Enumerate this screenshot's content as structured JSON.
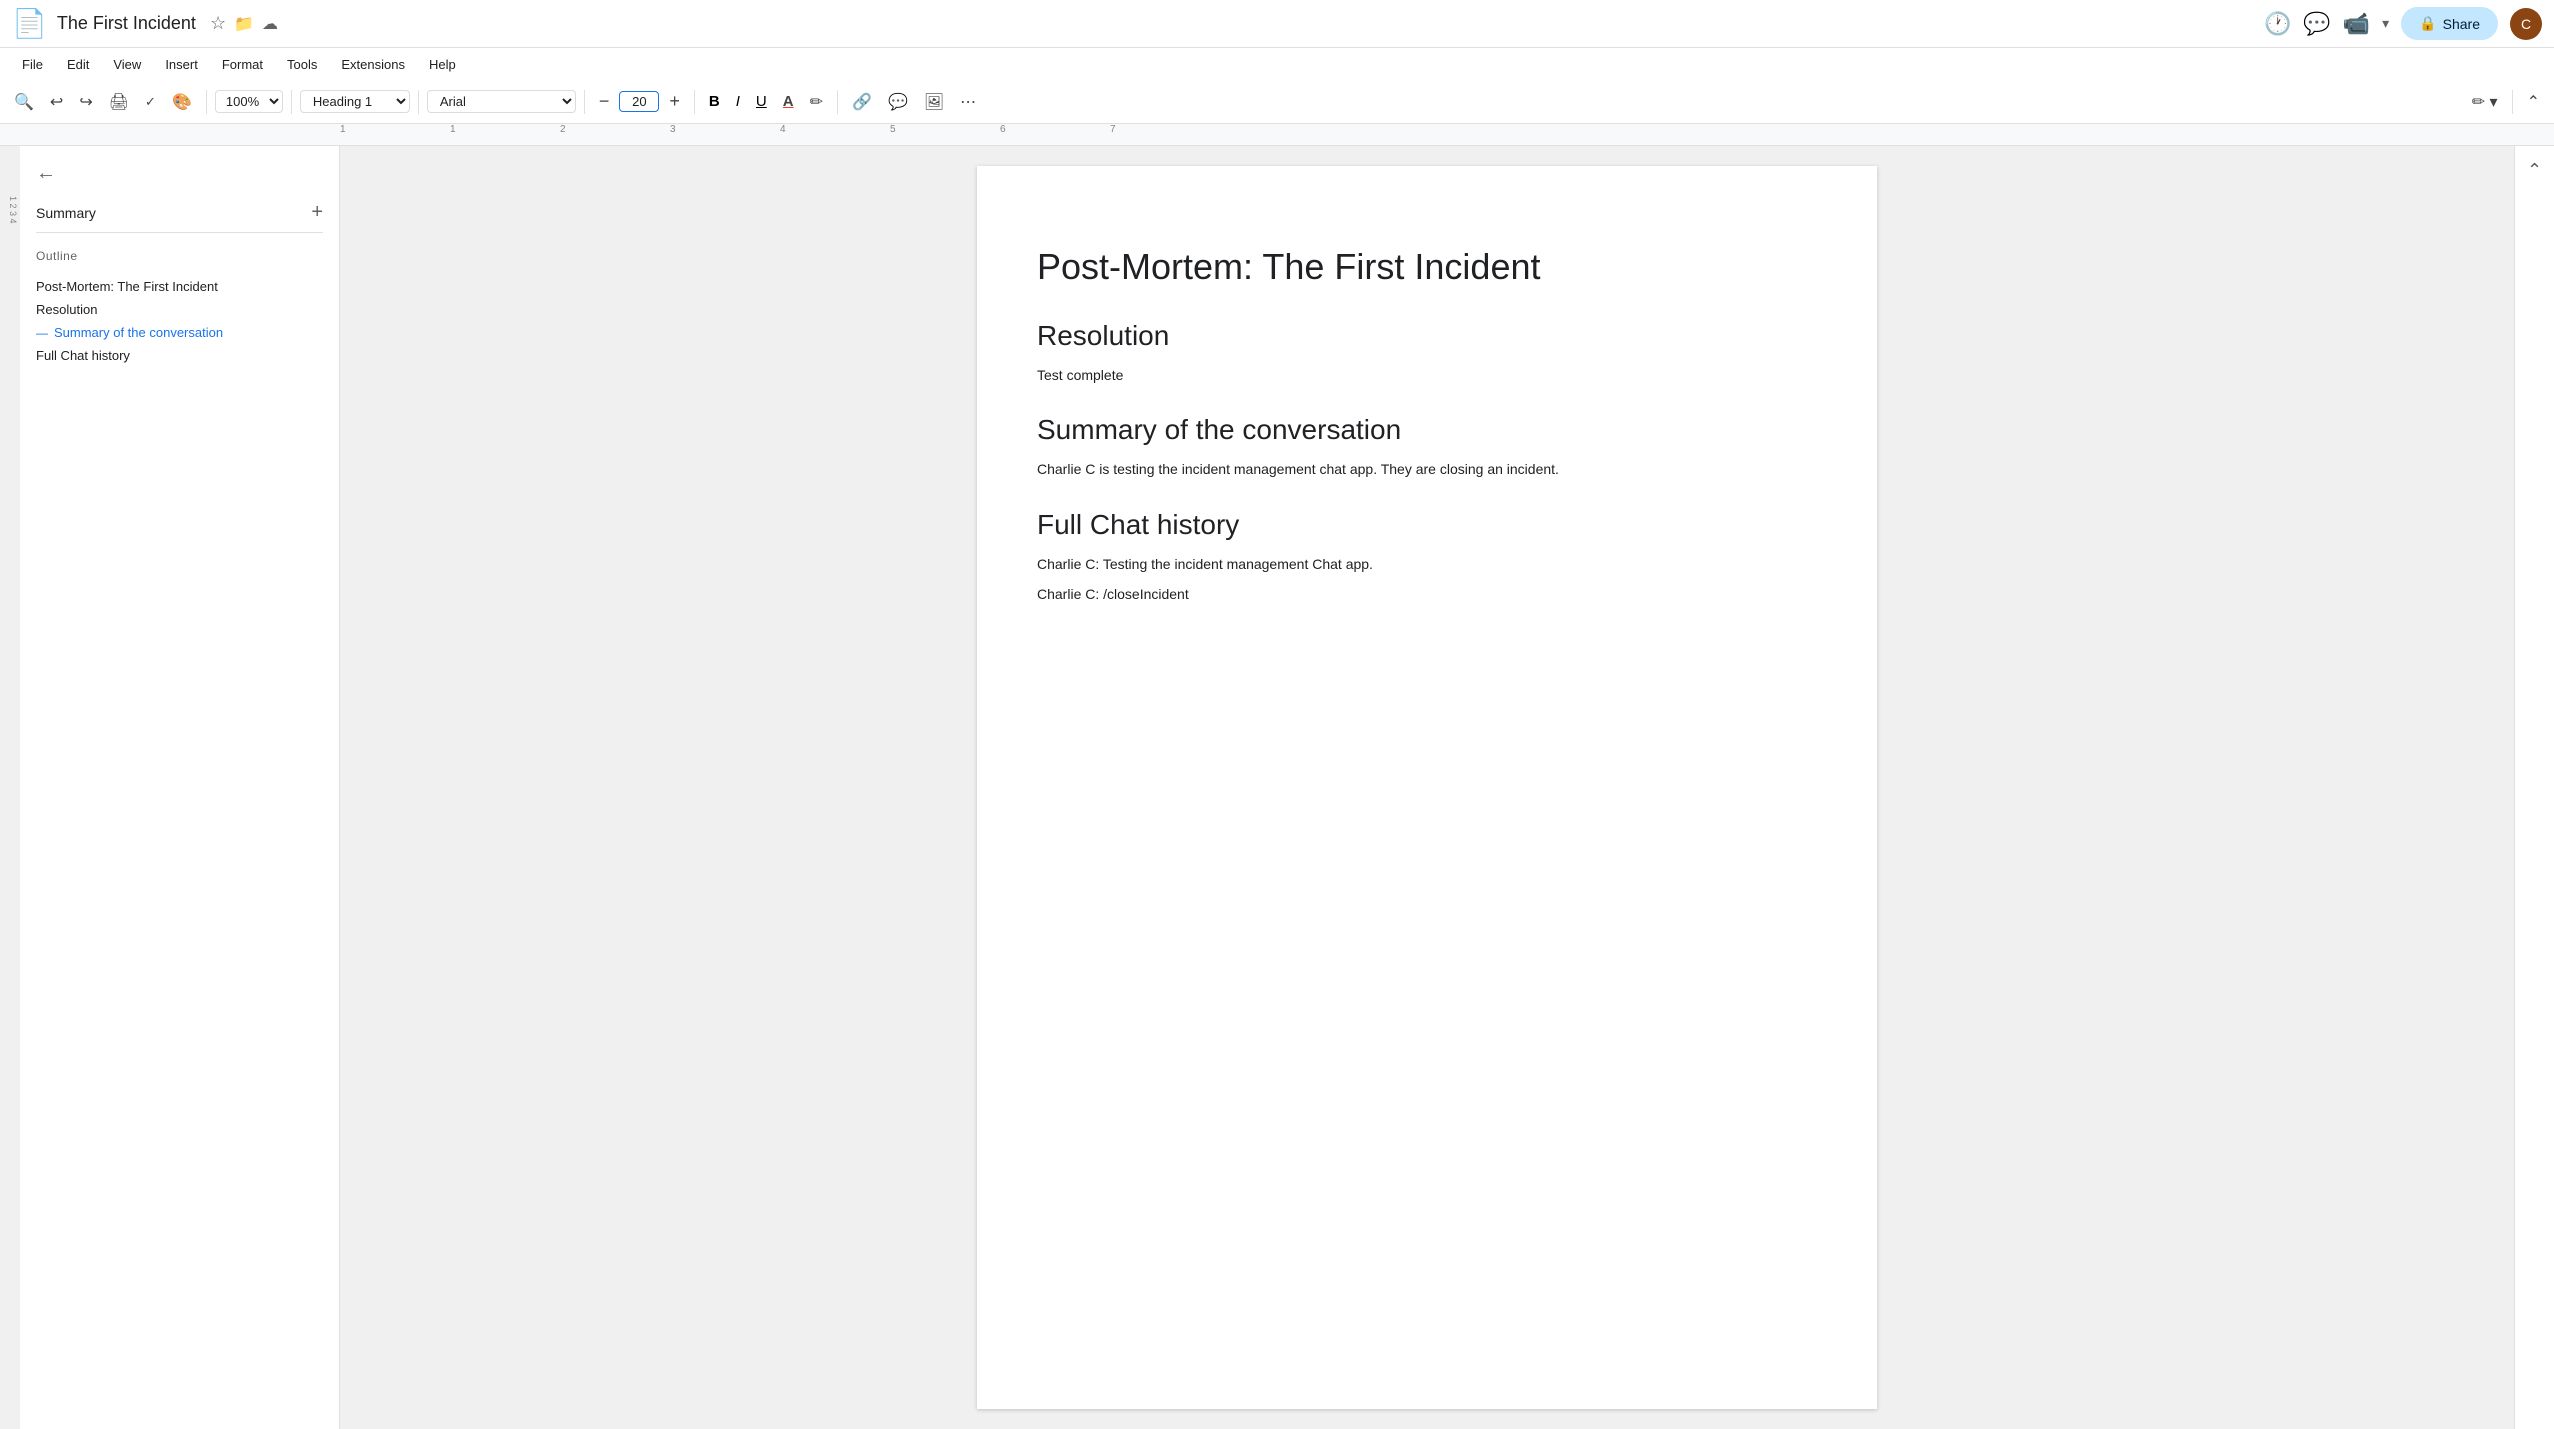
{
  "title_bar": {
    "doc_title": "The First Incident",
    "star_icon": "☆",
    "folder_icon": "📁",
    "cloud_icon": "☁",
    "share_label": "Share",
    "history_icon": "🕐",
    "comment_icon": "💬",
    "video_icon": "📹",
    "edit_icon": "✏️"
  },
  "menu": {
    "items": [
      "File",
      "Edit",
      "View",
      "Insert",
      "Format",
      "Tools",
      "Extensions",
      "Help"
    ]
  },
  "toolbar": {
    "search_icon": "🔍",
    "undo_icon": "↩",
    "redo_icon": "↪",
    "print_icon": "🖨",
    "spell_icon": "✓",
    "paint_icon": "🎨",
    "zoom_value": "100%",
    "style_value": "Heading 1",
    "font_value": "Arial",
    "font_size": "20",
    "decrease_font": "−",
    "increase_font": "+",
    "bold": "B",
    "italic": "I",
    "underline": "U",
    "text_color": "A",
    "highlight": "✏",
    "link": "🔗",
    "comment_icon": "💬",
    "image_icon": "🖼",
    "more_icon": "⋯",
    "pen_icon": "✏",
    "collapse_icon": "⌃"
  },
  "sidebar": {
    "back_label": "←",
    "summary_label": "Summary",
    "add_label": "+",
    "outline_label": "Outline",
    "outline_items": [
      {
        "text": "Post-Mortem: The First Incident",
        "active": false
      },
      {
        "text": "Resolution",
        "active": false
      },
      {
        "text": "Summary of the conversation",
        "active": true
      },
      {
        "text": "Full Chat history",
        "active": false
      }
    ]
  },
  "document": {
    "title": "Post-Mortem: The First Incident",
    "sections": [
      {
        "heading": "Resolution",
        "body": [
          "Test complete"
        ]
      },
      {
        "heading": "Summary of the conversation",
        "body": [
          "Charlie C is testing the incident management chat app. They are closing an incident."
        ]
      },
      {
        "heading": "Full Chat history",
        "body": [
          "Charlie C: Testing the incident management Chat app.",
          "Charlie C: /closeIncident"
        ]
      }
    ]
  }
}
